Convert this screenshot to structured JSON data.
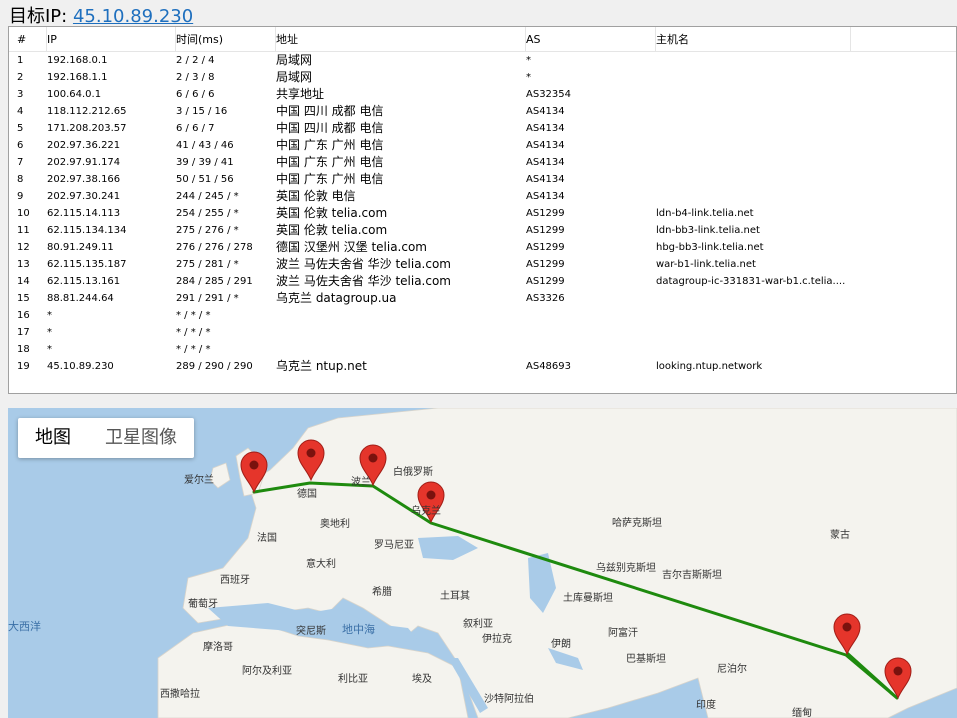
{
  "target": {
    "label": "目标IP: ",
    "ip": "45.10.89.230"
  },
  "table": {
    "columns": [
      "#",
      "IP",
      "时间(ms)",
      "地址",
      "AS",
      "主机名"
    ],
    "rows": [
      [
        "1",
        "192.168.0.1",
        "2 / 2 / 4",
        "局域网",
        "*",
        ""
      ],
      [
        "2",
        "192.168.1.1",
        "2 / 3 / 8",
        "局域网",
        "*",
        ""
      ],
      [
        "3",
        "100.64.0.1",
        "6 / 6 / 6",
        "共享地址",
        "AS32354",
        ""
      ],
      [
        "4",
        "118.112.212.65",
        "3 / 15 / 16",
        "中国 四川 成都 电信",
        "AS4134",
        ""
      ],
      [
        "5",
        "171.208.203.57",
        "6 / 6 / 7",
        "中国 四川 成都 电信",
        "AS4134",
        ""
      ],
      [
        "6",
        "202.97.36.221",
        "41 / 43 / 46",
        "中国 广东 广州 电信",
        "AS4134",
        ""
      ],
      [
        "7",
        "202.97.91.174",
        "39 / 39 / 41",
        "中国 广东 广州 电信",
        "AS4134",
        ""
      ],
      [
        "8",
        "202.97.38.166",
        "50 / 51 / 56",
        "中国 广东 广州 电信",
        "AS4134",
        ""
      ],
      [
        "9",
        "202.97.30.241",
        "244 / 245 / *",
        "英国 伦敦 电信",
        "AS4134",
        ""
      ],
      [
        "10",
        "62.115.14.113",
        "254 / 255 / *",
        "英国 伦敦 telia.com",
        "AS1299",
        "ldn-b4-link.telia.net"
      ],
      [
        "11",
        "62.115.134.134",
        "275 / 276 / *",
        "英国 伦敦 telia.com",
        "AS1299",
        "ldn-bb3-link.telia.net"
      ],
      [
        "12",
        "80.91.249.11",
        "276 / 276 / 278",
        "德国 汉堡州 汉堡 telia.com",
        "AS1299",
        "hbg-bb3-link.telia.net"
      ],
      [
        "13",
        "62.115.135.187",
        "275 / 281 / *",
        "波兰 马佐夫舍省 华沙 telia.com",
        "AS1299",
        "war-b1-link.telia.net"
      ],
      [
        "14",
        "62.115.13.161",
        "284 / 285 / 291",
        "波兰 马佐夫舍省 华沙 telia.com",
        "AS1299",
        "datagroup-ic-331831-war-b1.c.telia...."
      ],
      [
        "15",
        "88.81.244.64",
        "291 / 291 / *",
        "乌克兰 datagroup.ua",
        "AS3326",
        ""
      ],
      [
        "16",
        "*",
        "* / * / *",
        "",
        "",
        ""
      ],
      [
        "17",
        "*",
        "* / * / *",
        "",
        "",
        ""
      ],
      [
        "18",
        "*",
        "* / * / *",
        "",
        "",
        ""
      ],
      [
        "19",
        "45.10.89.230",
        "289 / 290 / 290",
        "乌克兰 ntup.net",
        "AS48693",
        "looking.ntup.network"
      ]
    ]
  },
  "map": {
    "type_buttons": {
      "map": "地图",
      "satellite": "卫星图像"
    },
    "labels": [
      "爱尔兰",
      "德国",
      "波兰",
      "白俄罗斯",
      "乌克兰",
      "法国",
      "奥地利",
      "罗马尼亚",
      "意大利",
      "西班牙",
      "葡萄牙",
      "希腊",
      "土耳其",
      "哈萨克斯坦",
      "乌兹别克斯坦",
      "吉尔吉斯斯坦",
      "土库曼斯坦",
      "蒙古",
      "大西洋",
      "突尼斯",
      "地中海",
      "叙利亚",
      "伊拉克",
      "伊朗",
      "阿富汗",
      "巴基斯坦",
      "摩洛哥",
      "阿尔及利亚",
      "利比亚",
      "埃及",
      "尼泊尔",
      "沙特阿拉伯",
      "印度",
      "西撒哈拉",
      "缅甸"
    ],
    "colors": {
      "route": "#1e8a0e",
      "marker": "#e5352b",
      "land": "#f4f3ee",
      "water": "#a9cbe8"
    }
  }
}
